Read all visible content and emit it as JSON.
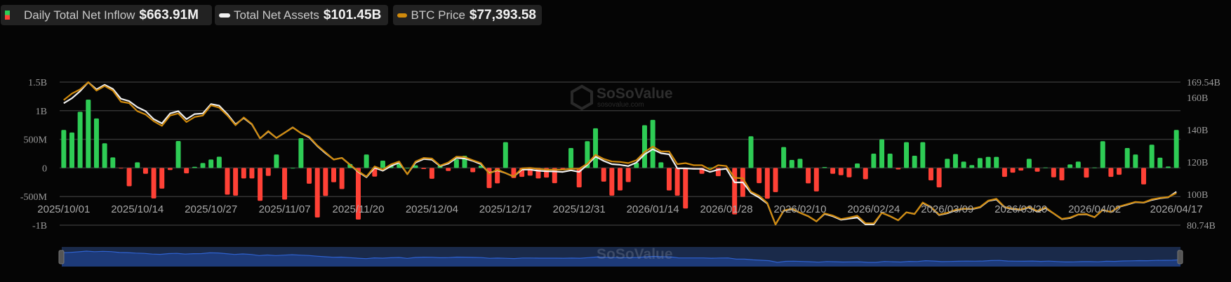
{
  "legend": {
    "inflow": {
      "label": "Daily Total Net Inflow",
      "value": "$663.91M"
    },
    "assets": {
      "label": "Total Net Assets",
      "value": "$101.45B"
    },
    "btc": {
      "label": "BTC Price",
      "value": "$77,393.58"
    }
  },
  "watermark": {
    "brand": "SoSoValue",
    "site": "sosovalue.com"
  },
  "colors": {
    "inflow_positive": "#2ecc55",
    "inflow_negative": "#ff4136",
    "assets_line": "#f0f0f0",
    "btc_line": "#d08a0c",
    "grid": "#333333",
    "slider_fill": "#1d3a78",
    "slider_line": "#2f62d0"
  },
  "chart_data": {
    "type": "bar+line",
    "x_tick_labels": [
      "2025/10/01",
      "2025/10/14",
      "2025/10/27",
      "2025/11/07",
      "2025/11/20",
      "2025/12/04",
      "2025/12/17",
      "2025/12/31",
      "2026/01/14",
      "2026/01/28",
      "2026/02/10",
      "2026/02/24",
      "2026/03/09",
      "2026/03/20",
      "2026/04/02",
      "2026/04/17"
    ],
    "left_axis": {
      "ticks": [
        "1.5B",
        "1B",
        "500M",
        "0",
        "-500M",
        "-1B"
      ],
      "tick_values_m": [
        1500,
        1000,
        500,
        0,
        -500,
        -1000
      ],
      "range_m": [
        -1000,
        1500
      ]
    },
    "right_axis": {
      "ticks": [
        "169.54B",
        "160B",
        "140B",
        "120B",
        "100B",
        "80.74B"
      ],
      "tick_values_b": [
        169.54,
        160,
        140,
        120,
        100,
        80.74
      ],
      "range_b": [
        80.74,
        169.54
      ]
    },
    "btc_axis_range": [
      62090,
      130380
    ],
    "grid": true,
    "dates": [
      "2025/10/01",
      "2025/10/02",
      "2025/10/03",
      "2025/10/06",
      "2025/10/07",
      "2025/10/08",
      "2025/10/09",
      "2025/10/10",
      "2025/10/13",
      "2025/10/14",
      "2025/10/15",
      "2025/10/16",
      "2025/10/17",
      "2025/10/20",
      "2025/10/21",
      "2025/10/22",
      "2025/10/23",
      "2025/10/24",
      "2025/10/27",
      "2025/10/28",
      "2025/10/29",
      "2025/10/30",
      "2025/10/31",
      "2025/11/03",
      "2025/11/04",
      "2025/11/05",
      "2025/11/06",
      "2025/11/07",
      "2025/11/10",
      "2025/11/11",
      "2025/11/12",
      "2025/11/13",
      "2025/11/14",
      "2025/11/17",
      "2025/11/18",
      "2025/11/19",
      "2025/11/20",
      "2025/11/21",
      "2025/11/24",
      "2025/11/25",
      "2025/11/26",
      "2025/11/28",
      "2025/12/01",
      "2025/12/02",
      "2025/12/03",
      "2025/12/04",
      "2025/12/05",
      "2025/12/08",
      "2025/12/09",
      "2025/12/10",
      "2025/12/11",
      "2025/12/12",
      "2025/12/15",
      "2025/12/16",
      "2025/12/17",
      "2025/12/18",
      "2025/12/19",
      "2025/12/22",
      "2025/12/23",
      "2025/12/24",
      "2025/12/26",
      "2025/12/29",
      "2025/12/30",
      "2025/12/31",
      "2026/01/02",
      "2026/01/05",
      "2026/01/06",
      "2026/01/07",
      "2026/01/08",
      "2026/01/09",
      "2026/01/12",
      "2026/01/13",
      "2026/01/14",
      "2026/01/15",
      "2026/01/16",
      "2026/01/20",
      "2026/01/21",
      "2026/01/22",
      "2026/01/23",
      "2026/01/26",
      "2026/01/27",
      "2026/01/28",
      "2026/01/29",
      "2026/01/30",
      "2026/02/02",
      "2026/02/03",
      "2026/02/04",
      "2026/02/05",
      "2026/02/06",
      "2026/02/09",
      "2026/02/10",
      "2026/02/11",
      "2026/02/12",
      "2026/02/13",
      "2026/02/17",
      "2026/02/18",
      "2026/02/19",
      "2026/02/20",
      "2026/02/23",
      "2026/02/24",
      "2026/02/25",
      "2026/02/26",
      "2026/02/27",
      "2026/03/02",
      "2026/03/03",
      "2026/03/04",
      "2026/03/05",
      "2026/03/06",
      "2026/03/09",
      "2026/03/10",
      "2026/03/11",
      "2026/03/12",
      "2026/03/13",
      "2026/03/16",
      "2026/03/17",
      "2026/03/18",
      "2026/03/19",
      "2026/03/20",
      "2026/03/23",
      "2026/03/24",
      "2026/03/25",
      "2026/03/26",
      "2026/03/27",
      "2026/03/30",
      "2026/03/31",
      "2026/04/01",
      "2026/04/02",
      "2026/04/06",
      "2026/04/07",
      "2026/04/08",
      "2026/04/09",
      "2026/04/10",
      "2026/04/13",
      "2026/04/14",
      "2026/04/15",
      "2026/04/16",
      "2026/04/17"
    ],
    "series": [
      {
        "name": "Daily Total Net Inflow",
        "type": "bar",
        "unit": "M USD",
        "values": [
          664,
          619,
          980,
          1193,
          865,
          430,
          184,
          -5,
          -320,
          98,
          -102,
          -533,
          -361,
          -37,
          471,
          -94,
          20,
          86,
          148,
          197,
          -467,
          -484,
          -184,
          -184,
          -574,
          -139,
          234,
          -553,
          0,
          520,
          -275,
          -865,
          -488,
          -250,
          -369,
          70,
          -902,
          234,
          -152,
          127,
          41,
          70,
          0,
          45,
          -20,
          -189,
          41,
          -53,
          152,
          213,
          -74,
          41,
          -352,
          -270,
          451,
          -176,
          -156,
          -135,
          -184,
          -168,
          -266,
          -25,
          348,
          -340,
          467,
          693,
          -238,
          -484,
          -393,
          -246,
          90,
          746,
          840,
          98,
          -393,
          -484,
          -709,
          -25,
          -102,
          8,
          -143,
          -5,
          -811,
          -504,
          553,
          -266,
          -537,
          -422,
          365,
          139,
          160,
          -270,
          -410,
          16,
          -102,
          -127,
          -164,
          78,
          -197,
          250,
          500,
          250,
          -25,
          451,
          213,
          451,
          -217,
          -340,
          160,
          242,
          111,
          49,
          172,
          193,
          193,
          -156,
          -82,
          -45,
          160,
          -66,
          8,
          -164,
          -217,
          61,
          111,
          -168,
          8,
          467,
          -156,
          -119,
          348,
          234,
          -287,
          406,
          180,
          25,
          663.91
        ]
      },
      {
        "name": "Total Net Assets",
        "type": "line",
        "unit": "B USD",
        "values": [
          156.4,
          159.5,
          163.9,
          169.4,
          165.0,
          167.9,
          165.3,
          159.2,
          157.7,
          154.0,
          151.5,
          146.5,
          143.9,
          150.1,
          151.5,
          146.5,
          149.7,
          150.1,
          155.9,
          154.9,
          149.7,
          143.3,
          147.2,
          143.3,
          134.6,
          138.9,
          134.9,
          138.1,
          141.4,
          137.8,
          135.2,
          129.8,
          125.4,
          121.5,
          122.5,
          118.2,
          113.8,
          110.5,
          116.4,
          114.5,
          117.4,
          119.6,
          112.4,
          119.6,
          121.8,
          121.4,
          117.4,
          118.9,
          122.5,
          122.1,
          120.6,
          118.6,
          113.1,
          114.8,
          113.1,
          110.9,
          115.2,
          115.2,
          114.5,
          114.2,
          114.1,
          113.8,
          114.8,
          113.8,
          118.2,
          123.3,
          120.6,
          118.6,
          118.2,
          117.4,
          119.6,
          124.7,
          127.9,
          125.4,
          124.7,
          116.0,
          116.0,
          115.7,
          115.7,
          113.8,
          115.2,
          115.7,
          107.3,
          107.3,
          100.8,
          97.9,
          94.2,
          81.2,
          89.6,
          90.6,
          88.4,
          86.3,
          83.1,
          87.7,
          86.3,
          84.1,
          84.8,
          85.5,
          81.2,
          81.2,
          88.4,
          86.3,
          83.8,
          88.7,
          87.7,
          94.5,
          91.8,
          87.0,
          88.1,
          89.9,
          90.9,
          90.6,
          91.8,
          95.7,
          96.7,
          91.8,
          90.6,
          90.2,
          91.8,
          89.1,
          91.3,
          88.0,
          84.5,
          85.2,
          87.3,
          87.5,
          85.7,
          90.2,
          88.9,
          92.1,
          93.5,
          95.0,
          94.7,
          96.4,
          97.4,
          98.0,
          101.45
        ]
      },
      {
        "name": "BTC Price",
        "type": "line",
        "unit": "USD",
        "values": [
          121800,
          124900,
          126900,
          130300,
          126300,
          128500,
          126300,
          121000,
          120300,
          116500,
          114900,
          111700,
          109500,
          114400,
          115400,
          111300,
          113700,
          114400,
          119300,
          118200,
          114400,
          109800,
          113500,
          110400,
          103500,
          107000,
          103700,
          106200,
          108700,
          106000,
          104300,
          100100,
          96800,
          93400,
          94200,
          90900,
          87800,
          85300,
          90100,
          88600,
          91100,
          92500,
          86400,
          92500,
          94200,
          93900,
          90500,
          92000,
          94800,
          94600,
          93100,
          91700,
          86700,
          88600,
          87000,
          85300,
          89200,
          89400,
          89000,
          88600,
          88600,
          88600,
          89000,
          89000,
          91400,
          95700,
          93700,
          92500,
          92300,
          91700,
          93100,
          97000,
          99600,
          97300,
          97300,
          91200,
          91700,
          90700,
          90700,
          88600,
          90700,
          90300,
          84700,
          84500,
          78100,
          76100,
          72700,
          62400,
          69100,
          70000,
          68000,
          66400,
          63900,
          67700,
          66700,
          65000,
          65700,
          66600,
          63000,
          63000,
          68000,
          66400,
          64400,
          68200,
          67400,
          72900,
          70800,
          67100,
          68000,
          69400,
          70000,
          69900,
          70800,
          73800,
          74700,
          70800,
          70000,
          69600,
          70800,
          68900,
          70600,
          67700,
          65100,
          65700,
          67200,
          67400,
          65900,
          69400,
          68400,
          71000,
          72100,
          73200,
          72900,
          74400,
          75100,
          75500,
          77393.58
        ]
      }
    ]
  }
}
